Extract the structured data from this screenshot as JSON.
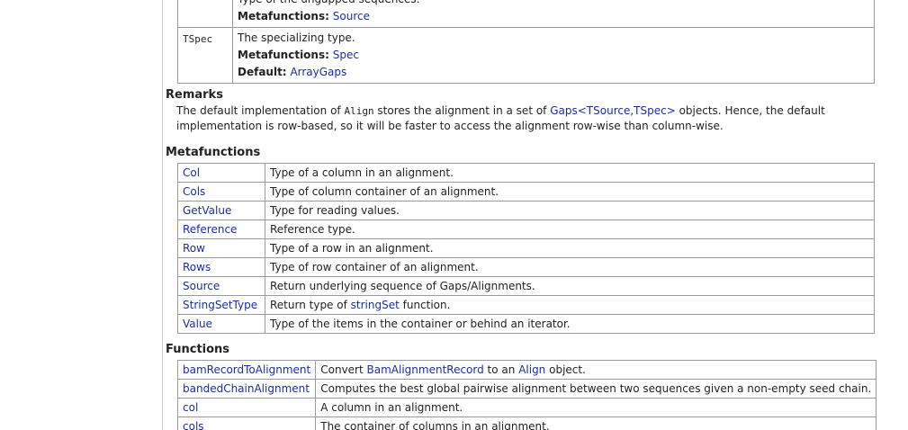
{
  "params": [
    {
      "name": "",
      "desc": "Type of the ungapped sequences.",
      "metafunctions_label": "Metafunctions:",
      "metafunctions_link": "Source"
    },
    {
      "name": "TSpec",
      "desc": "The specializing type.",
      "metafunctions_label": "Metafunctions:",
      "metafunctions_link": "Spec",
      "default_label": "Default:",
      "default_link": "ArrayGaps"
    }
  ],
  "remarks": {
    "heading": "Remarks",
    "text_1": "The default implementation of ",
    "code": "Align",
    "text_2": " stores the alignment in a set of ",
    "link": "Gaps<TSource,TSpec>",
    "text_3": " objects. Hence, the default implementation is row-based, so it will be faster to access the alignment row-wise than column-wise."
  },
  "metafunctions": {
    "heading": "Metafunctions",
    "rows": [
      {
        "name": "Col",
        "desc": "Type of a column in an alignment."
      },
      {
        "name": "Cols",
        "desc": "Type of column container of an alignment."
      },
      {
        "name": "GetValue",
        "desc": "Type for reading values."
      },
      {
        "name": "Reference",
        "desc": "Reference type."
      },
      {
        "name": "Row",
        "desc": "Type of a row in an alignment."
      },
      {
        "name": "Rows",
        "desc": "Type of row container of an alignment."
      },
      {
        "name": "Source",
        "desc": "Return underlying sequence of Gaps/Alignments."
      },
      {
        "name": "StringSetType",
        "desc_1": "Return type of ",
        "desc_link": "stringSet",
        "desc_2": " function."
      },
      {
        "name": "Value",
        "desc": "Type of the items in the container or behind an iterator."
      }
    ]
  },
  "functions": {
    "heading": "Functions",
    "rows": [
      {
        "name": "bamRecordToAlignment",
        "desc_1": "Convert ",
        "desc_link_1": "BamAlignmentRecord",
        "desc_2": " to an ",
        "desc_link_2": "Align",
        "desc_3": " object."
      },
      {
        "name": "bandedChainAlignment",
        "desc": "Computes the best global pairwise alignment between two sequences given a non-empty seed chain."
      },
      {
        "name": "col",
        "desc": "A column in an alignment."
      },
      {
        "name": "cols",
        "desc": "The container of columns in an alignment."
      }
    ]
  }
}
